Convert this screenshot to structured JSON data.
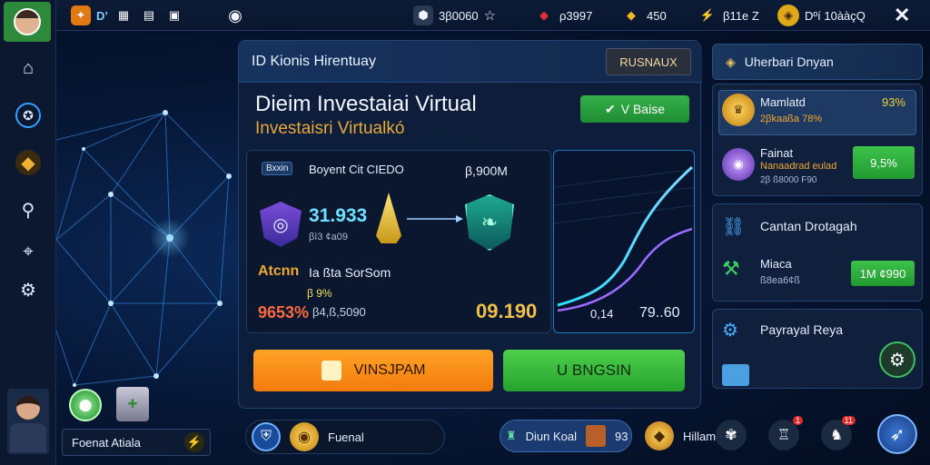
{
  "topbar": {
    "tab_label": "D’",
    "stat1": "3β0060",
    "stat2": "ρ3997",
    "stat3": "450",
    "stat4": "β11e Z",
    "stat5": "Dºí 10ààçQ"
  },
  "main": {
    "header_title": "ID Kionis Hirentuay",
    "header_tag": "RUSNAUX",
    "heading_line1": "Dieim Investaiai Virtual",
    "heading_line2": "Investaisri Virtualkó",
    "status_button": "V Baise",
    "card": {
      "tag": "Bxxin",
      "title": "Boyent Cit CIEDO",
      "amount_top": "β,900M",
      "value": "31.933",
      "value_sub": "βì3 ¢a09",
      "label_left": "Atcnn",
      "label_mid": "Ia ßta SorSom",
      "percent_small": "β 9%",
      "percent_big": "9653%",
      "amount_mid": "β4,ß,5090",
      "amount_big": "09.190"
    },
    "chart": {
      "left_val": "0,14",
      "right_val": "79..60"
    },
    "btn_orange": "VINSJPAM",
    "btn_green": "U BNGSIN"
  },
  "right_panel": {
    "title": "Uherbari Dnyan",
    "row1_title": "Mamlatd",
    "row1_sub": "2βkaaßa 78%",
    "row1_pct": "93%",
    "row2_title": "Fainat",
    "row2_sub1": "Nanaadrad eulad",
    "row2_sub2": "2β ß8000 F90",
    "row2_pct": "9,5%",
    "section2_title": "Cantan Drotagah",
    "row3_title": "Miaca",
    "row3_sub": "ß8ea6¢ß",
    "row3_val": "1M ¢990",
    "section3_title": "Payrayal Reya"
  },
  "bottom": {
    "left_label": "Foenat Atiala",
    "pill1_label": "Fuenal",
    "pill2_label": "Diun Koal",
    "pill2_num": "93",
    "pill3_label": "Hillam",
    "badge1": "1",
    "badge2": "11",
    "badge3": "11"
  }
}
